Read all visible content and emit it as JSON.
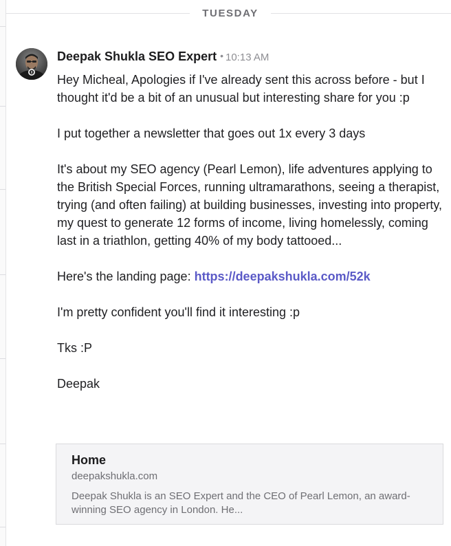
{
  "day_divider": {
    "label": "TUESDAY"
  },
  "message": {
    "sender": "Deepak Shukla SEO Expert",
    "separator": "•",
    "time": "10:13 AM",
    "avatar_icon": "avatar-photo",
    "paragraphs": {
      "p1": "Hey Micheal, Apologies if I've already sent this across before - but I thought it'd be a bit of an unusual but interesting share for you :p",
      "p2": "I put together a newsletter that goes out 1x every 3 days",
      "p3": "It's about my SEO agency (Pearl Lemon), life adventures applying to the British Special Forces, running ultramarathons, seeing a therapist, trying (and often failing) at building businesses, investing into property, my quest to generate 12 forms of income, living homelessly, coming last in a triathlon, getting 40% of my body tattooed...",
      "p4_prefix": "Here's the landing page: ",
      "p4_link": "https://deepakshukla.com/52k",
      "p5": "I'm pretty confident you'll find it interesting :p",
      "p6": "Tks :P",
      "p7": "Deepak"
    },
    "link_preview": {
      "title": "Home",
      "domain": "deepakshukla.com",
      "description": "Deepak Shukla is an SEO Expert and the CEO of Pearl Lemon, an award-winning SEO agency in London. He..."
    }
  },
  "colors": {
    "link": "#5b5ac7",
    "muted_text": "#6e6e73",
    "card_background": "#f4f4f6",
    "divider": "#e1e1e4"
  }
}
